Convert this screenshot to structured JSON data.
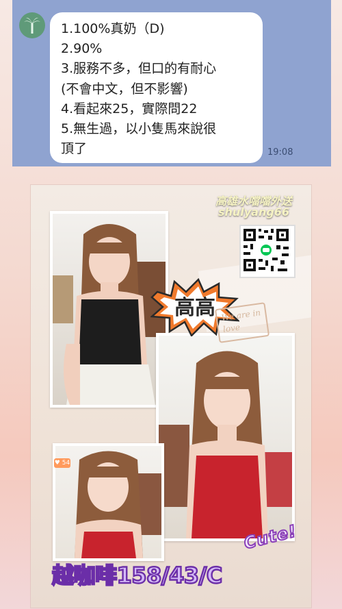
{
  "chat": {
    "message_lines": [
      "1.100%真奶（D)",
      "2.90%",
      "3.服務不多，但口的有耐心",
      "(不會中文，但不影響)",
      "4.看起來25，實際問22",
      "5.無生過，以小隻馬來說很",
      "頂了"
    ],
    "timestamp": "19:08",
    "avatar_icon": "palm-tree-icon"
  },
  "poster": {
    "promo_line1": "高雄水噹噹外送",
    "promo_line2": "shulyang66",
    "name_burst": "高高",
    "stamp_text": "We are in love",
    "cute_text": "Cute!",
    "headline": "越咖啡158/43/C",
    "like_badge": "54",
    "qr_icon": "qr-code-icon",
    "colors": {
      "chat_background": "#8fa3d0",
      "headline_fill": "#d4b8f7",
      "headline_stroke": "#6b2ea8",
      "burst_fill": "#f07a2d"
    }
  }
}
